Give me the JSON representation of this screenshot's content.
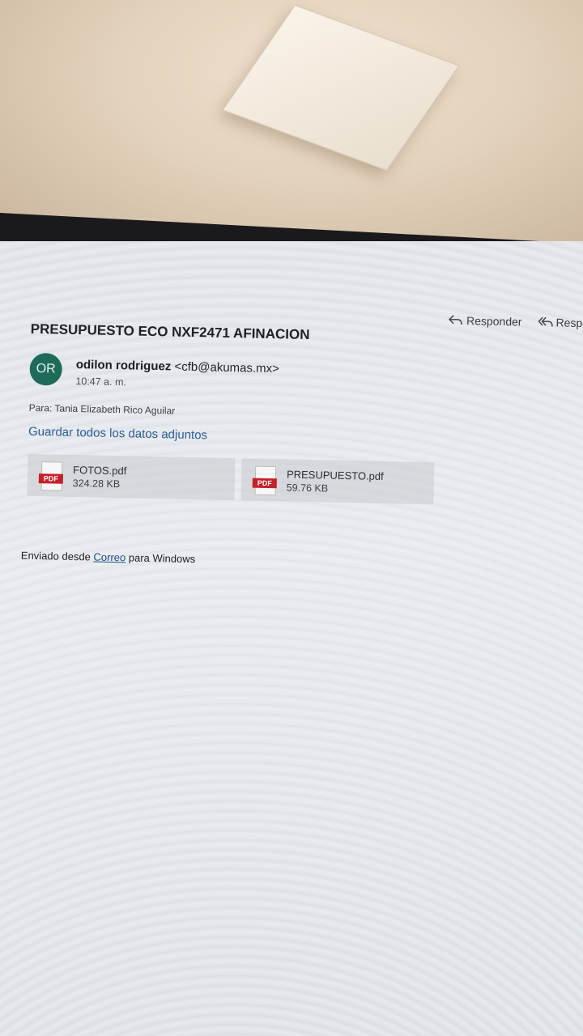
{
  "toolbar": {
    "reply_label": "Responder",
    "reply_all_label": "Respon"
  },
  "email": {
    "subject": "PRESUPUESTO ECO NXF2471 AFINACION",
    "sender_initials": "OR",
    "sender_name": "odilon rodriguez",
    "sender_email": "<cfb@akumas.mx>",
    "time": "10:47 a. m.",
    "to_label": "Para:",
    "to_value": "Tania Elizabeth Rico Aguilar",
    "save_all_label": "Guardar todos los datos adjuntos",
    "attachments": [
      {
        "icon": "pdf-icon",
        "icon_text": "PDF",
        "name": "FOTOS.pdf",
        "size": "324.28 KB"
      },
      {
        "icon": "pdf-icon",
        "icon_text": "PDF",
        "name": "PRESUPUESTO.pdf",
        "size": "59.76 KB"
      }
    ],
    "signature_prefix": "Enviado desde",
    "signature_link": "Correo",
    "signature_suffix": "para Windows"
  },
  "colors": {
    "avatar_bg": "#1e6b5a",
    "link": "#2a5d96",
    "pdf_red": "#c6202a"
  }
}
